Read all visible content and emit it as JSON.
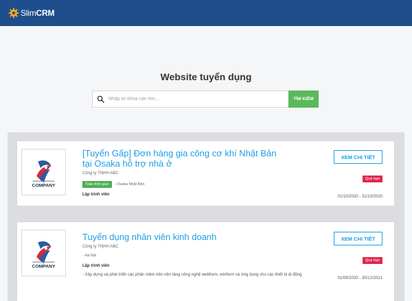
{
  "header": {
    "brand_light": "Slim",
    "brand_bold": "CRM",
    "logo_icon": "gear-icon",
    "bg_color": "#1e4f8c"
  },
  "page": {
    "heading": "Website tuyển dụng"
  },
  "search": {
    "placeholder": "Nhập từ khóa cần tìm...",
    "value": "",
    "button_label": "TÌM KIẾM",
    "icon": "search-icon",
    "button_color": "#5cb85c"
  },
  "jobs": [
    {
      "title": "[Tuyển Gấp] Đơn hàng gia công cơ khí Nhật Bản tại Osaka hỗ trợ nhà ở",
      "company": "Công ty TNHH ABC",
      "work_type": "Toàn thời gian",
      "location": "- Osaka Nhật Bản",
      "role": "Lập trình viên",
      "description": "",
      "detail_label": "XEM CHI TIẾT",
      "status": "Quá hạn",
      "date_range": "01/10/2020 - 31/10/2020",
      "logo_text": "COMPANY"
    },
    {
      "title": "Tuyển dụng nhân viên kinh doanh",
      "company": "Công ty TNHH ABC",
      "work_type": "",
      "location": "- Hà Nội",
      "role": "Lập trình viên",
      "description": "- Xây dựng và phát triển các phần mềm trên nền tảng công nghệ webform, winform và ứng dụng cho các thiết bị di động",
      "detail_label": "XEM CHI TIẾT",
      "status": "Quá hạn",
      "date_range": "01/09/2020 - 30/12/2021",
      "logo_text": "COMPANY"
    }
  ],
  "colors": {
    "accent_blue": "#1e9ee5",
    "status_red": "#e2264d",
    "tag_green": "#4caf50"
  }
}
